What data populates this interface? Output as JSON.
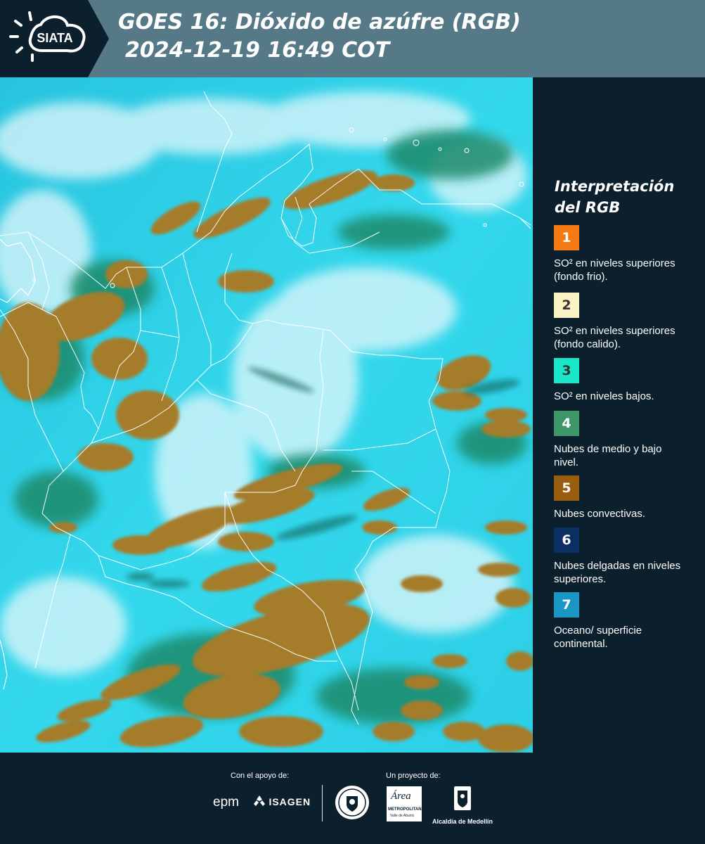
{
  "header": {
    "logo_text": "SIATA",
    "title_line1": "GOES 16: Dióxido de azúfre (RGB)",
    "title_line2": "2024-12-19 16:49 COT",
    "colors": {
      "bar": "#557987",
      "logo_panel": "#0c1f2c"
    }
  },
  "map": {
    "icon": "satellite-image",
    "colors": {
      "surface": "#2fd3e6",
      "convective": "#a07a2a",
      "mid_low": "#1f8a6a",
      "thin_high": "#d9f2f8",
      "borders": "#ffffff"
    }
  },
  "legend": {
    "title": "Interpretación del RGB",
    "items": [
      {
        "number": "1",
        "color": "#f47a14",
        "num_color": "#ffffff",
        "text": "SO² en niveles superiores (fondo frio)."
      },
      {
        "number": "2",
        "color": "#fbf3c3",
        "num_color": "#333333",
        "text": "SO² en niveles superiores (fondo calido)."
      },
      {
        "number": "3",
        "color": "#19e8c8",
        "num_color": "#333333",
        "text": "SO² en niveles bajos."
      },
      {
        "number": "4",
        "color": "#3e9668",
        "num_color": "#ffffff",
        "text": "Nubes de medio y bajo nivel."
      },
      {
        "number": "5",
        "color": "#9a5c0f",
        "num_color": "#ffffff",
        "text": "Nubes convectivas."
      },
      {
        "number": "6",
        "color": "#0c2f63",
        "num_color": "#ffffff",
        "text": "Nubes delgadas en niveles superiores."
      },
      {
        "number": "7",
        "color": "#1a96c4",
        "num_color": "#ffffff",
        "text": "Oceano/ superficie continental."
      }
    ]
  },
  "footer": {
    "support_label": "Con el apoyo de:",
    "project_label": "Un proyecto de:",
    "sponsors": {
      "epm": "epm",
      "isagen": "ISAGEN",
      "metropolitana_name": "Área",
      "metropolitana_sub": "METROPOLITANA",
      "metropolitana_sub2": "Valle de Aburrá",
      "alcaldia": "Alcaldía de Medellín"
    }
  }
}
